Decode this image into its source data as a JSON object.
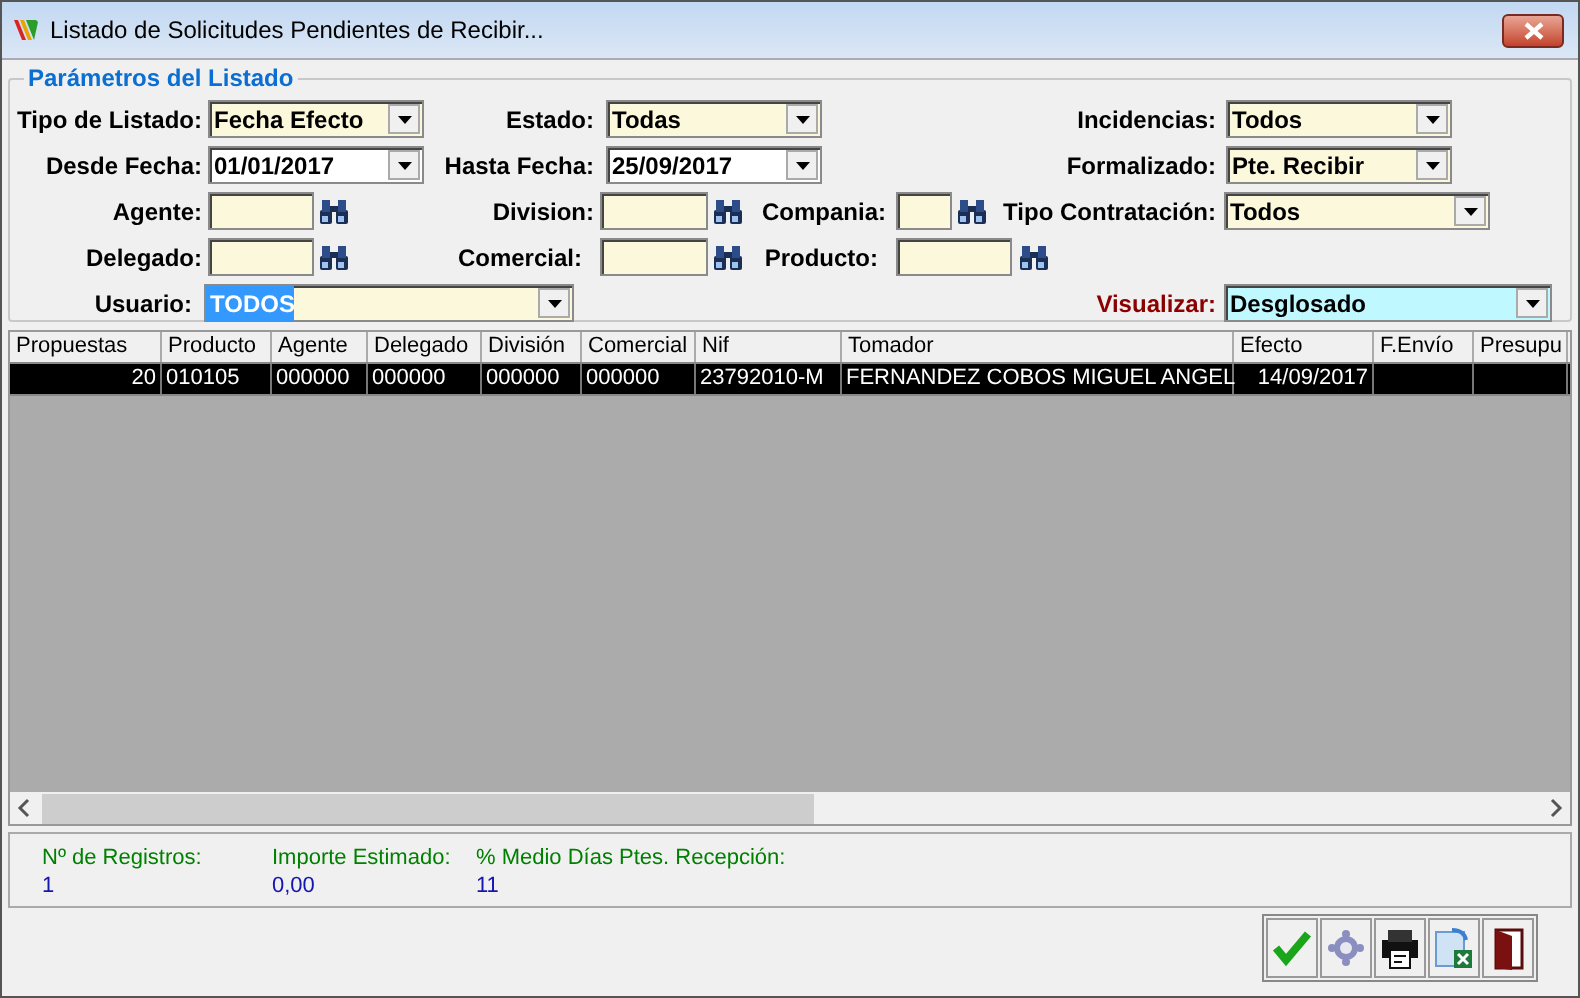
{
  "window": {
    "title": "Listado de Solicitudes Pendientes de Recibir..."
  },
  "parameters": {
    "title": "Parámetros del Listado",
    "fields": [
      {
        "kind": "combo",
        "label": "Tipo de Listado:",
        "value": "Fecha Efecto",
        "emphasized": false,
        "focused": false
      },
      {
        "kind": "combo",
        "label": "Estado:",
        "value": "Todas",
        "emphasized": false,
        "focused": false
      },
      {
        "kind": "combo",
        "label": "Incidencias:",
        "value": "Todos",
        "emphasized": false,
        "focused": false
      },
      {
        "kind": "date",
        "label": "Desde Fecha:",
        "value": "01/01/2017",
        "emphasized": false,
        "focused": false
      },
      {
        "kind": "date",
        "label": "Hasta Fecha:",
        "value": "25/09/2017",
        "emphasized": false,
        "focused": false
      },
      {
        "kind": "combo",
        "label": "Formalizado:",
        "value": "Pte. Recibir",
        "emphasized": false,
        "focused": false
      },
      {
        "kind": "lookup",
        "label": "Agente:",
        "emphasized": false
      },
      {
        "kind": "lookup",
        "label": "Division:",
        "emphasized": false
      },
      {
        "kind": "lookup",
        "label": "Compania:",
        "emphasized": false
      },
      {
        "kind": "combo",
        "label": "Tipo Contratación:",
        "value": "Todos",
        "emphasized": false,
        "focused": false
      },
      {
        "kind": "lookup",
        "label": "Delegado:",
        "emphasized": false
      },
      {
        "kind": "lookup",
        "label": "Comercial:",
        "emphasized": false
      },
      {
        "kind": "lookup",
        "label": "Producto:",
        "emphasized": false
      },
      {
        "kind": "combo",
        "label": "Usuario:",
        "value": "TODOS",
        "emphasized": false,
        "focused": true
      },
      {
        "kind": "combo",
        "label": "Visualizar:",
        "value": "Desglosado",
        "emphasized": true,
        "focused": false
      }
    ]
  },
  "table": {
    "columns": [
      "Propuestas",
      "Producto",
      "Agente",
      "Delegado",
      "División",
      "Comercial",
      "Nif",
      "Tomador",
      "Efecto",
      "F.Envío",
      "Presupu"
    ],
    "rows": [
      {
        "selected": true,
        "cells": [
          "20",
          "010105",
          "000000",
          "000000",
          "000000",
          "000000",
          "23792010-M",
          "FERNANDEZ COBOS MIGUEL ANGEL",
          " 14/09/2017"
        ]
      }
    ]
  },
  "summary": [
    {
      "label": "Nº de Registros:",
      "value": "1"
    },
    {
      "label": "Importe Estimado:",
      "value": "0,00"
    },
    {
      "label": "% Medio Días Ptes. Recepción:",
      "value": "11"
    }
  ],
  "toolbar": [
    {
      "kind": "accept"
    },
    {
      "kind": "settings"
    },
    {
      "kind": "print"
    },
    {
      "kind": "excel"
    },
    {
      "kind": "exit"
    }
  ]
}
